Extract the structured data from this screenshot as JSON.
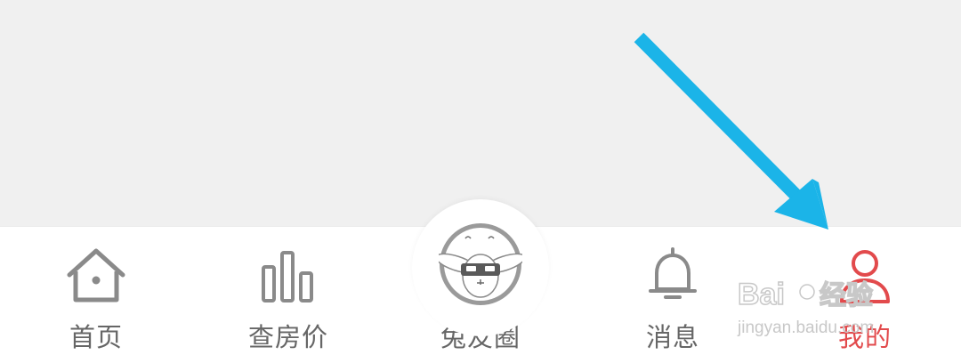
{
  "tabbar": {
    "tabs": [
      {
        "label": "首页",
        "icon": "home-icon"
      },
      {
        "label": "查房价",
        "icon": "bar-chart-icon"
      },
      {
        "label": "兔友圈",
        "icon": "rabbit-avatar-icon"
      },
      {
        "label": "消息",
        "icon": "bell-icon"
      },
      {
        "label": "我的",
        "icon": "user-icon"
      }
    ],
    "active_index": 4
  },
  "watermark": {
    "brand": "Baidu经验",
    "url": "jingyan.baidu.com"
  },
  "colors": {
    "background": "#f0f0f0",
    "tabbar": "#ffffff",
    "icon_inactive": "#8a8a8a",
    "label_inactive": "#666666",
    "active": "#e24a4c",
    "arrow": "#1bb4e8"
  }
}
